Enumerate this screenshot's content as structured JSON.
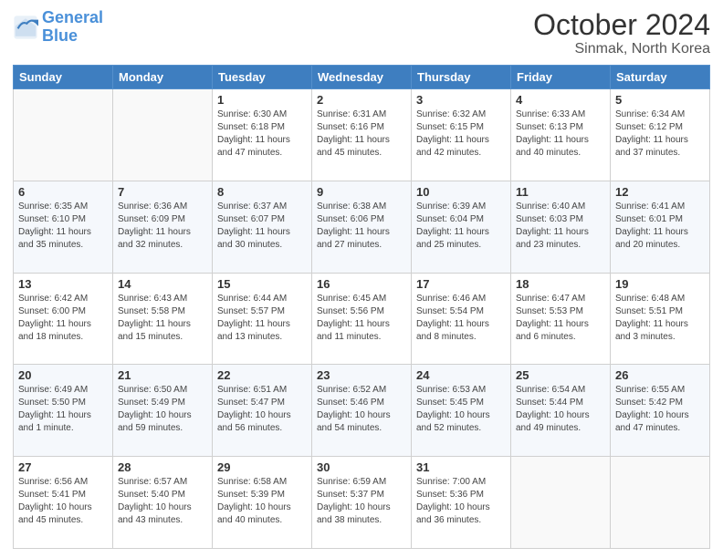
{
  "header": {
    "logo_text_general": "General",
    "logo_text_blue": "Blue",
    "title": "October 2024",
    "subtitle": "Sinmak, North Korea"
  },
  "weekdays": [
    "Sunday",
    "Monday",
    "Tuesday",
    "Wednesday",
    "Thursday",
    "Friday",
    "Saturday"
  ],
  "weeks": [
    [
      {
        "day": "",
        "sunrise": "",
        "sunset": "",
        "daylight": ""
      },
      {
        "day": "",
        "sunrise": "",
        "sunset": "",
        "daylight": ""
      },
      {
        "day": "1",
        "sunrise": "Sunrise: 6:30 AM",
        "sunset": "Sunset: 6:18 PM",
        "daylight": "Daylight: 11 hours and 47 minutes."
      },
      {
        "day": "2",
        "sunrise": "Sunrise: 6:31 AM",
        "sunset": "Sunset: 6:16 PM",
        "daylight": "Daylight: 11 hours and 45 minutes."
      },
      {
        "day": "3",
        "sunrise": "Sunrise: 6:32 AM",
        "sunset": "Sunset: 6:15 PM",
        "daylight": "Daylight: 11 hours and 42 minutes."
      },
      {
        "day": "4",
        "sunrise": "Sunrise: 6:33 AM",
        "sunset": "Sunset: 6:13 PM",
        "daylight": "Daylight: 11 hours and 40 minutes."
      },
      {
        "day": "5",
        "sunrise": "Sunrise: 6:34 AM",
        "sunset": "Sunset: 6:12 PM",
        "daylight": "Daylight: 11 hours and 37 minutes."
      }
    ],
    [
      {
        "day": "6",
        "sunrise": "Sunrise: 6:35 AM",
        "sunset": "Sunset: 6:10 PM",
        "daylight": "Daylight: 11 hours and 35 minutes."
      },
      {
        "day": "7",
        "sunrise": "Sunrise: 6:36 AM",
        "sunset": "Sunset: 6:09 PM",
        "daylight": "Daylight: 11 hours and 32 minutes."
      },
      {
        "day": "8",
        "sunrise": "Sunrise: 6:37 AM",
        "sunset": "Sunset: 6:07 PM",
        "daylight": "Daylight: 11 hours and 30 minutes."
      },
      {
        "day": "9",
        "sunrise": "Sunrise: 6:38 AM",
        "sunset": "Sunset: 6:06 PM",
        "daylight": "Daylight: 11 hours and 27 minutes."
      },
      {
        "day": "10",
        "sunrise": "Sunrise: 6:39 AM",
        "sunset": "Sunset: 6:04 PM",
        "daylight": "Daylight: 11 hours and 25 minutes."
      },
      {
        "day": "11",
        "sunrise": "Sunrise: 6:40 AM",
        "sunset": "Sunset: 6:03 PM",
        "daylight": "Daylight: 11 hours and 23 minutes."
      },
      {
        "day": "12",
        "sunrise": "Sunrise: 6:41 AM",
        "sunset": "Sunset: 6:01 PM",
        "daylight": "Daylight: 11 hours and 20 minutes."
      }
    ],
    [
      {
        "day": "13",
        "sunrise": "Sunrise: 6:42 AM",
        "sunset": "Sunset: 6:00 PM",
        "daylight": "Daylight: 11 hours and 18 minutes."
      },
      {
        "day": "14",
        "sunrise": "Sunrise: 6:43 AM",
        "sunset": "Sunset: 5:58 PM",
        "daylight": "Daylight: 11 hours and 15 minutes."
      },
      {
        "day": "15",
        "sunrise": "Sunrise: 6:44 AM",
        "sunset": "Sunset: 5:57 PM",
        "daylight": "Daylight: 11 hours and 13 minutes."
      },
      {
        "day": "16",
        "sunrise": "Sunrise: 6:45 AM",
        "sunset": "Sunset: 5:56 PM",
        "daylight": "Daylight: 11 hours and 11 minutes."
      },
      {
        "day": "17",
        "sunrise": "Sunrise: 6:46 AM",
        "sunset": "Sunset: 5:54 PM",
        "daylight": "Daylight: 11 hours and 8 minutes."
      },
      {
        "day": "18",
        "sunrise": "Sunrise: 6:47 AM",
        "sunset": "Sunset: 5:53 PM",
        "daylight": "Daylight: 11 hours and 6 minutes."
      },
      {
        "day": "19",
        "sunrise": "Sunrise: 6:48 AM",
        "sunset": "Sunset: 5:51 PM",
        "daylight": "Daylight: 11 hours and 3 minutes."
      }
    ],
    [
      {
        "day": "20",
        "sunrise": "Sunrise: 6:49 AM",
        "sunset": "Sunset: 5:50 PM",
        "daylight": "Daylight: 11 hours and 1 minute."
      },
      {
        "day": "21",
        "sunrise": "Sunrise: 6:50 AM",
        "sunset": "Sunset: 5:49 PM",
        "daylight": "Daylight: 10 hours and 59 minutes."
      },
      {
        "day": "22",
        "sunrise": "Sunrise: 6:51 AM",
        "sunset": "Sunset: 5:47 PM",
        "daylight": "Daylight: 10 hours and 56 minutes."
      },
      {
        "day": "23",
        "sunrise": "Sunrise: 6:52 AM",
        "sunset": "Sunset: 5:46 PM",
        "daylight": "Daylight: 10 hours and 54 minutes."
      },
      {
        "day": "24",
        "sunrise": "Sunrise: 6:53 AM",
        "sunset": "Sunset: 5:45 PM",
        "daylight": "Daylight: 10 hours and 52 minutes."
      },
      {
        "day": "25",
        "sunrise": "Sunrise: 6:54 AM",
        "sunset": "Sunset: 5:44 PM",
        "daylight": "Daylight: 10 hours and 49 minutes."
      },
      {
        "day": "26",
        "sunrise": "Sunrise: 6:55 AM",
        "sunset": "Sunset: 5:42 PM",
        "daylight": "Daylight: 10 hours and 47 minutes."
      }
    ],
    [
      {
        "day": "27",
        "sunrise": "Sunrise: 6:56 AM",
        "sunset": "Sunset: 5:41 PM",
        "daylight": "Daylight: 10 hours and 45 minutes."
      },
      {
        "day": "28",
        "sunrise": "Sunrise: 6:57 AM",
        "sunset": "Sunset: 5:40 PM",
        "daylight": "Daylight: 10 hours and 43 minutes."
      },
      {
        "day": "29",
        "sunrise": "Sunrise: 6:58 AM",
        "sunset": "Sunset: 5:39 PM",
        "daylight": "Daylight: 10 hours and 40 minutes."
      },
      {
        "day": "30",
        "sunrise": "Sunrise: 6:59 AM",
        "sunset": "Sunset: 5:37 PM",
        "daylight": "Daylight: 10 hours and 38 minutes."
      },
      {
        "day": "31",
        "sunrise": "Sunrise: 7:00 AM",
        "sunset": "Sunset: 5:36 PM",
        "daylight": "Daylight: 10 hours and 36 minutes."
      },
      {
        "day": "",
        "sunrise": "",
        "sunset": "",
        "daylight": ""
      },
      {
        "day": "",
        "sunrise": "",
        "sunset": "",
        "daylight": ""
      }
    ]
  ]
}
